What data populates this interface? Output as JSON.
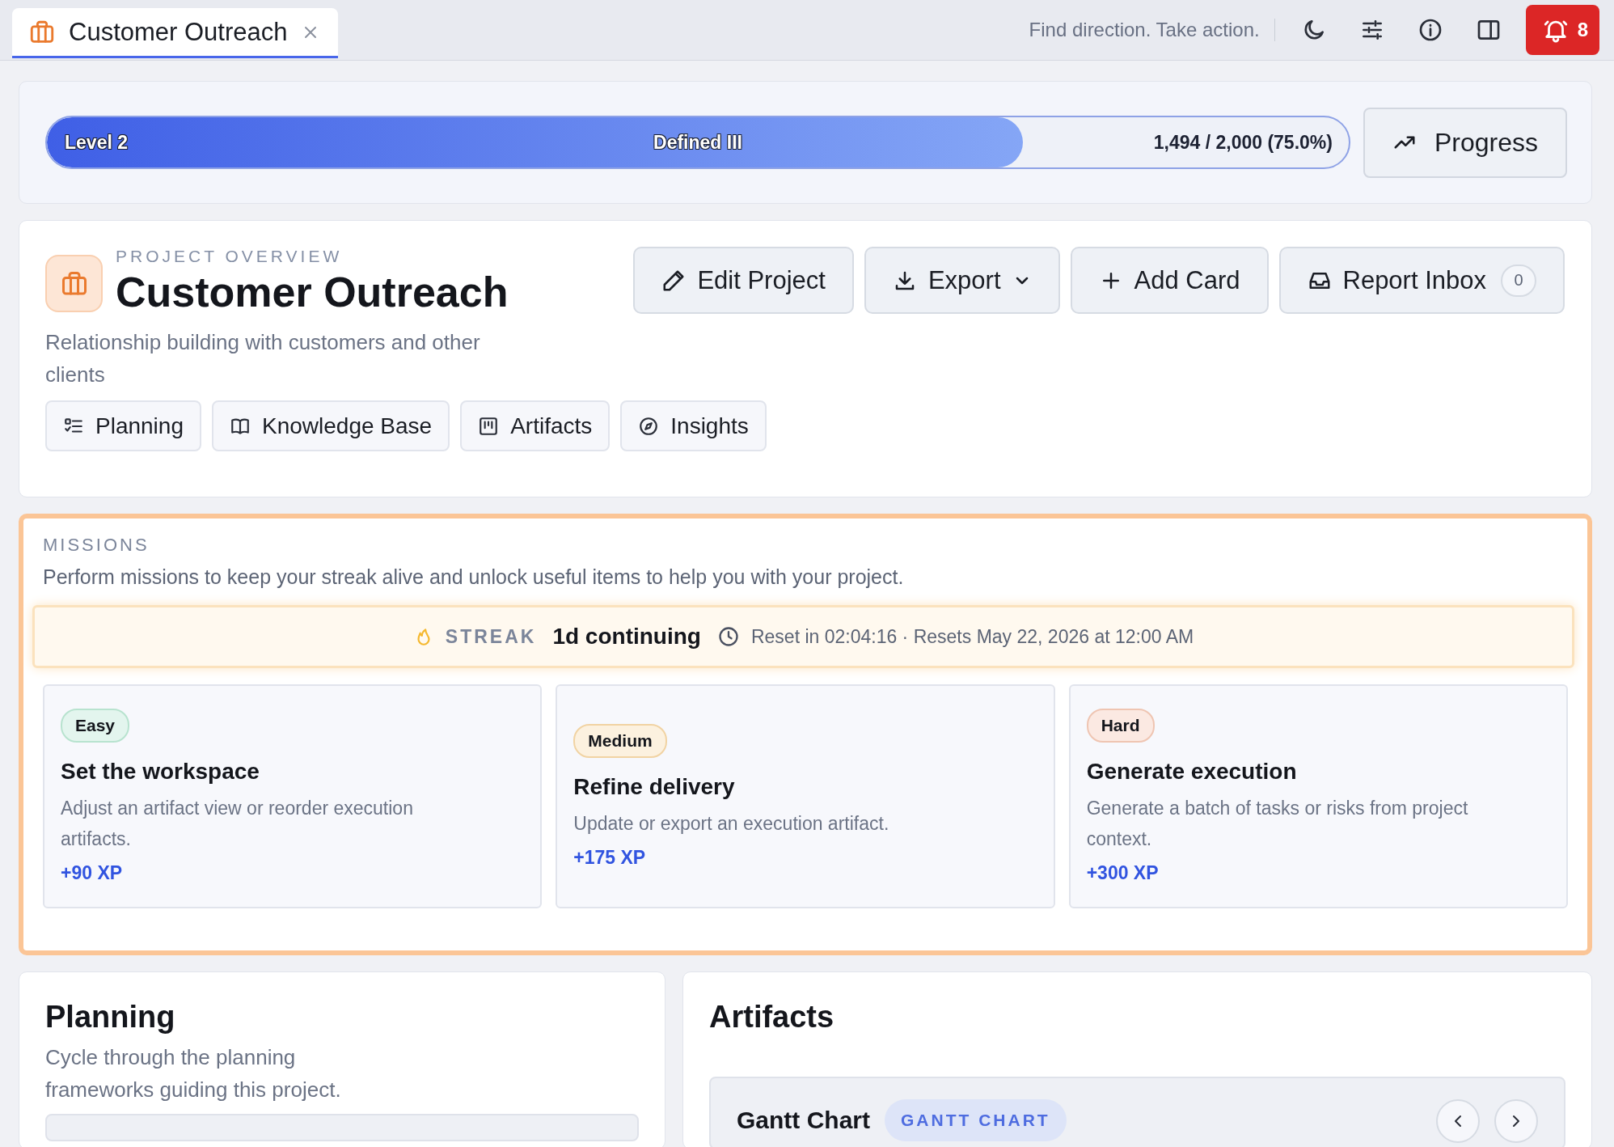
{
  "tab": {
    "title": "Customer Outreach",
    "selected": true
  },
  "header": {
    "tagline": "Find direction. Take action.",
    "notification_count": "8"
  },
  "progress": {
    "level_label": "Level 2",
    "rank": "Defined III",
    "reading": "1,494 / 2,000 (75.0%)",
    "level": 0.75,
    "button": "Progress"
  },
  "project": {
    "eyebrow": "PROJECT OVERVIEW",
    "title": "Customer Outreach",
    "description": "Relationship building with customers and other clients",
    "actions": [
      {
        "label": "Edit Project",
        "dropdown": false
      },
      {
        "label": "Export",
        "dropdown": true
      },
      {
        "label": "Add Card",
        "dropdown": false
      },
      {
        "label": "Report Inbox",
        "dropdown": false,
        "count": "0"
      }
    ],
    "nav": [
      {
        "label": "Planning"
      },
      {
        "label": "Knowledge Base"
      },
      {
        "label": "Artifacts"
      },
      {
        "label": "Insights"
      }
    ]
  },
  "missions": {
    "heading": "MISSIONS",
    "description": "Perform missions to keep your streak alive and unlock useful items to help you with your project.",
    "streak": {
      "label": "STREAK",
      "value": "1d continuing",
      "reset": "Reset in 02:04:16 · Resets May 22, 2026 at 12:00 AM"
    },
    "items": [
      {
        "kind": "easy",
        "difficulty": "Easy",
        "title": "Set the workspace",
        "description": "Adjust an artifact view or reorder execution artifacts.",
        "reward": "+90 XP"
      },
      {
        "kind": "medium",
        "difficulty": "Medium",
        "title": "Refine delivery",
        "description": "Update or export an execution artifact.",
        "reward": "+175 XP"
      },
      {
        "kind": "hard",
        "difficulty": "Hard",
        "title": "Generate execution",
        "description": "Generate a batch of tasks or risks from project context.",
        "reward": "+300 XP"
      }
    ]
  },
  "planning": {
    "title": "Planning",
    "description": "Cycle through the planning frameworks guiding this project."
  },
  "artifacts": {
    "title": "Artifacts",
    "current": {
      "title": "Gantt Chart",
      "type": "GANTT CHART"
    }
  }
}
